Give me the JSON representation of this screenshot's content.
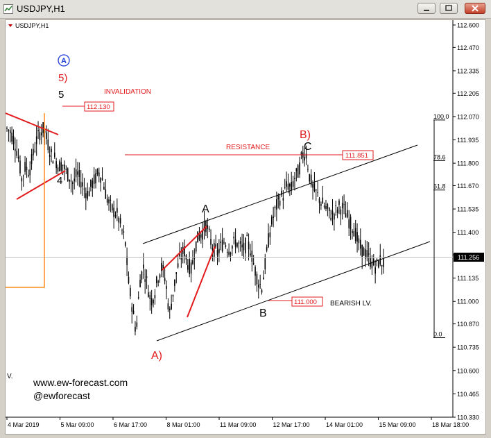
{
  "window": {
    "title": "USDJPY,H1",
    "chart_label": "USDJPY,H1",
    "buttons": [
      "minimize",
      "restore",
      "close"
    ]
  },
  "watermark": {
    "site": "www.ew-forecast.com",
    "handle": "@ewforecast"
  },
  "annotations": {
    "invalidation": "INVALIDATION",
    "resistance": "RESISTANCE",
    "bearish": "BEARISH LV.",
    "corner_v": "V."
  },
  "colors": {
    "background": "#ffffff",
    "candles": "#000000",
    "wave_red": "#e31a1c",
    "wave_blue": "#1f3bd6",
    "fib_box": "#ff8c1a",
    "label_box": "#e31a1c",
    "grid_current": "#c0c0c0"
  },
  "chart_data": {
    "type": "candlestick",
    "symbol": "USDJPY",
    "timeframe": "H1",
    "ylim": [
      110.33,
      112.6
    ],
    "yticks": [
      112.6,
      112.47,
      112.335,
      112.205,
      112.07,
      111.935,
      111.8,
      111.67,
      111.535,
      111.4,
      111.27,
      111.135,
      111.0,
      110.87,
      110.735,
      110.6,
      110.465,
      110.33
    ],
    "ytick_labels": [
      "112.600",
      "112.470",
      "112.335",
      "112.205",
      "112.070",
      "111.935",
      "111.800",
      "111.670",
      "111.535",
      "111.400",
      "111.270",
      "111.135",
      "111.000",
      "110.870",
      "110.735",
      "110.600",
      "110.465",
      "110.330"
    ],
    "xtick_labels": [
      "4 Mar 2019",
      "5 Mar 09:00",
      "6 Mar 17:00",
      "8 Mar 01:00",
      "11 Mar 09:00",
      "12 Mar 17:00",
      "14 Mar 01:00",
      "15 Mar 09:00",
      "18 Mar 18:00"
    ],
    "current_price": 111.256,
    "current_price_label": "111.256",
    "levels": [
      {
        "label": "112.130",
        "value": 112.13
      },
      {
        "label": "111.851",
        "value": 111.851
      },
      {
        "label": "111.000",
        "value": 111.0
      }
    ],
    "fib_levels": [
      {
        "label": "100.0",
        "value": 112.05
      },
      {
        "label": "78.6",
        "value": 111.815
      },
      {
        "label": "61.8",
        "value": 111.645
      },
      {
        "label": "0.0",
        "value": 110.79
      }
    ],
    "wave_labels": [
      {
        "text": "Ⓐ",
        "color": "#1f3bd6"
      },
      {
        "text": "5)",
        "color": "#e31a1c"
      },
      {
        "text": "5",
        "color": "#000000"
      },
      {
        "text": "4",
        "color": "#000000"
      },
      {
        "text": "A)",
        "color": "#e31a1c"
      },
      {
        "text": "A",
        "color": "#000000"
      },
      {
        "text": "B",
        "color": "#000000"
      },
      {
        "text": "B)",
        "color": "#e31a1c"
      },
      {
        "text": "C",
        "color": "#000000"
      }
    ],
    "close_path": [
      112.0,
      111.98,
      111.93,
      111.85,
      111.71,
      111.78,
      111.75,
      111.84,
      111.93,
      111.98,
      112.0,
      111.92,
      111.85,
      111.83,
      111.78,
      111.8,
      111.75,
      111.72,
      111.68,
      111.74,
      111.7,
      111.65,
      111.62,
      111.68,
      111.71,
      111.75,
      111.7,
      111.6,
      111.55,
      111.52,
      111.5,
      111.42,
      111.35,
      111.1,
      110.96,
      110.82,
      111.12,
      111.2,
      111.1,
      111.0,
      111.05,
      111.15,
      111.2,
      111.12,
      110.92,
      111.05,
      111.18,
      111.25,
      111.3,
      111.22,
      111.18,
      111.32,
      111.38,
      111.4,
      111.45,
      111.36,
      111.3,
      111.28,
      111.32,
      111.35,
      111.3,
      111.32,
      111.35,
      111.32,
      111.3,
      111.34,
      111.3,
      111.2,
      111.12,
      111.08,
      111.22,
      111.38,
      111.48,
      111.55,
      111.6,
      111.62,
      111.68,
      111.65,
      111.72,
      111.75,
      111.85,
      111.86,
      111.72,
      111.65,
      111.62,
      111.58,
      111.55,
      111.52,
      111.5,
      111.52,
      111.55,
      111.54,
      111.5,
      111.45,
      111.42,
      111.35,
      111.3,
      111.28,
      111.25,
      111.22,
      111.2,
      111.24,
      111.22
    ]
  }
}
